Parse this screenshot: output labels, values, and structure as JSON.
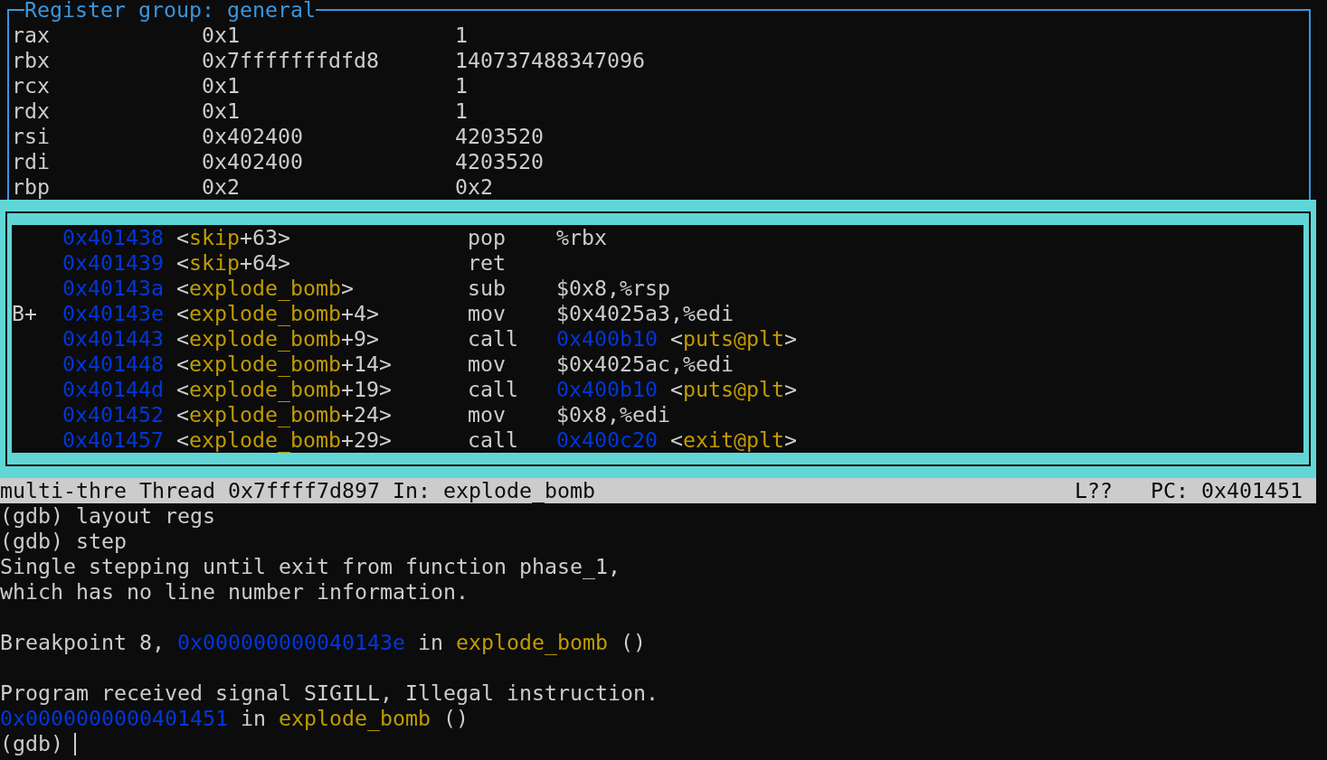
{
  "register_window": {
    "title": "Register group: general",
    "registers": [
      {
        "name": "rax",
        "hex": "0x1",
        "natural": "1"
      },
      {
        "name": "rbx",
        "hex": "0x7fffffffdfd8",
        "natural": "140737488347096"
      },
      {
        "name": "rcx",
        "hex": "0x1",
        "natural": "1"
      },
      {
        "name": "rdx",
        "hex": "0x1",
        "natural": "1"
      },
      {
        "name": "rsi",
        "hex": "0x402400",
        "natural": "4203520"
      },
      {
        "name": "rdi",
        "hex": "0x402400",
        "natural": "4203520"
      },
      {
        "name": "rbp",
        "hex": "0x2",
        "natural": "0x2"
      }
    ]
  },
  "asm_window": {
    "rows": [
      {
        "address": "0x401438",
        "location": [
          {
            "kind": "plain",
            "text": "<"
          },
          {
            "kind": "symbol",
            "text": "skip"
          },
          {
            "kind": "plain",
            "text": "+63>"
          }
        ],
        "mnemonic": "pop",
        "operands": [
          {
            "kind": "plain",
            "text": "%rbx"
          }
        ]
      },
      {
        "address": "0x401439",
        "location": [
          {
            "kind": "plain",
            "text": "<"
          },
          {
            "kind": "symbol",
            "text": "skip"
          },
          {
            "kind": "plain",
            "text": "+64>"
          }
        ],
        "mnemonic": "ret"
      },
      {
        "address": "0x40143a",
        "location": [
          {
            "kind": "plain",
            "text": "<"
          },
          {
            "kind": "symbol",
            "text": "explode_bomb"
          },
          {
            "kind": "plain",
            "text": ">"
          }
        ],
        "mnemonic": "sub",
        "operands": [
          {
            "kind": "plain",
            "text": "$0x8,%rsp"
          }
        ]
      },
      {
        "breakpoint": "B+",
        "address": "0x40143e",
        "location": [
          {
            "kind": "plain",
            "text": "<"
          },
          {
            "kind": "symbol",
            "text": "explode_bomb"
          },
          {
            "kind": "plain",
            "text": "+4>"
          }
        ],
        "mnemonic": "mov",
        "operands": [
          {
            "kind": "plain",
            "text": "$0x4025a3,%edi"
          }
        ]
      },
      {
        "address": "0x401443",
        "location": [
          {
            "kind": "plain",
            "text": "<"
          },
          {
            "kind": "symbol",
            "text": "explode_bomb"
          },
          {
            "kind": "plain",
            "text": "+9>"
          }
        ],
        "mnemonic": "call",
        "operands": [
          {
            "kind": "address",
            "text": "0x400b10"
          },
          {
            "kind": "plain",
            "text": " <"
          },
          {
            "kind": "symbol",
            "text": "puts@plt"
          },
          {
            "kind": "plain",
            "text": ">"
          }
        ]
      },
      {
        "address": "0x401448",
        "location": [
          {
            "kind": "plain",
            "text": "<"
          },
          {
            "kind": "symbol",
            "text": "explode_bomb"
          },
          {
            "kind": "plain",
            "text": "+14>"
          }
        ],
        "mnemonic": "mov",
        "operands": [
          {
            "kind": "plain",
            "text": "$0x4025ac,%edi"
          }
        ]
      },
      {
        "address": "0x40144d",
        "location": [
          {
            "kind": "plain",
            "text": "<"
          },
          {
            "kind": "symbol",
            "text": "explode_bomb"
          },
          {
            "kind": "plain",
            "text": "+19>"
          }
        ],
        "mnemonic": "call",
        "operands": [
          {
            "kind": "address",
            "text": "0x400b10"
          },
          {
            "kind": "plain",
            "text": " <"
          },
          {
            "kind": "symbol",
            "text": "puts@plt"
          },
          {
            "kind": "plain",
            "text": ">"
          }
        ]
      },
      {
        "address": "0x401452",
        "location": [
          {
            "kind": "plain",
            "text": "<"
          },
          {
            "kind": "symbol",
            "text": "explode_bomb"
          },
          {
            "kind": "plain",
            "text": "+24>"
          }
        ],
        "mnemonic": "mov",
        "operands": [
          {
            "kind": "plain",
            "text": "$0x8,%edi"
          }
        ]
      },
      {
        "address": "0x401457",
        "location": [
          {
            "kind": "plain",
            "text": "<"
          },
          {
            "kind": "symbol",
            "text": "explode_bomb"
          },
          {
            "kind": "plain",
            "text": "+29>"
          }
        ],
        "mnemonic": "call",
        "operands": [
          {
            "kind": "address",
            "text": "0x400c20"
          },
          {
            "kind": "plain",
            "text": " <"
          },
          {
            "kind": "symbol",
            "text": "exit@plt"
          },
          {
            "kind": "plain",
            "text": ">"
          }
        ]
      }
    ]
  },
  "status_bar": {
    "target": "multi-thre",
    "thread": "Thread 0x7ffff7d897",
    "function": "In: explode_bomb",
    "line": "L??",
    "pc": "PC: 0x401451"
  },
  "console": {
    "blocks": [
      {
        "lines": [
          {
            "segments": [
              {
                "kind": "plain",
                "text": "(gdb) layout regs"
              }
            ]
          },
          {
            "segments": [
              {
                "kind": "plain",
                "text": "(gdb) step"
              }
            ]
          },
          {
            "segments": [
              {
                "kind": "plain",
                "text": "Single stepping until exit from function phase_1,"
              }
            ]
          },
          {
            "segments": [
              {
                "kind": "plain",
                "text": "which has no line number information."
              }
            ]
          }
        ]
      },
      {
        "lines": [
          {
            "segments": [
              {
                "kind": "plain",
                "text": "Breakpoint 8, "
              },
              {
                "kind": "address",
                "text": "0x000000000040143e"
              },
              {
                "kind": "plain",
                "text": " in "
              },
              {
                "kind": "symbol",
                "text": "explode_bomb"
              },
              {
                "kind": "plain",
                "text": " ()"
              }
            ]
          }
        ]
      },
      {
        "lines": [
          {
            "segments": [
              {
                "kind": "plain",
                "text": "Program received signal SIGILL, Illegal instruction."
              }
            ]
          },
          {
            "segments": [
              {
                "kind": "address",
                "text": "0x0000000000401451"
              },
              {
                "kind": "plain",
                "text": " in "
              },
              {
                "kind": "symbol",
                "text": "explode_bomb"
              },
              {
                "kind": "plain",
                "text": " ()"
              }
            ]
          }
        ]
      }
    ],
    "prompt": {
      "text": "(gdb)",
      "cursor": true
    }
  }
}
